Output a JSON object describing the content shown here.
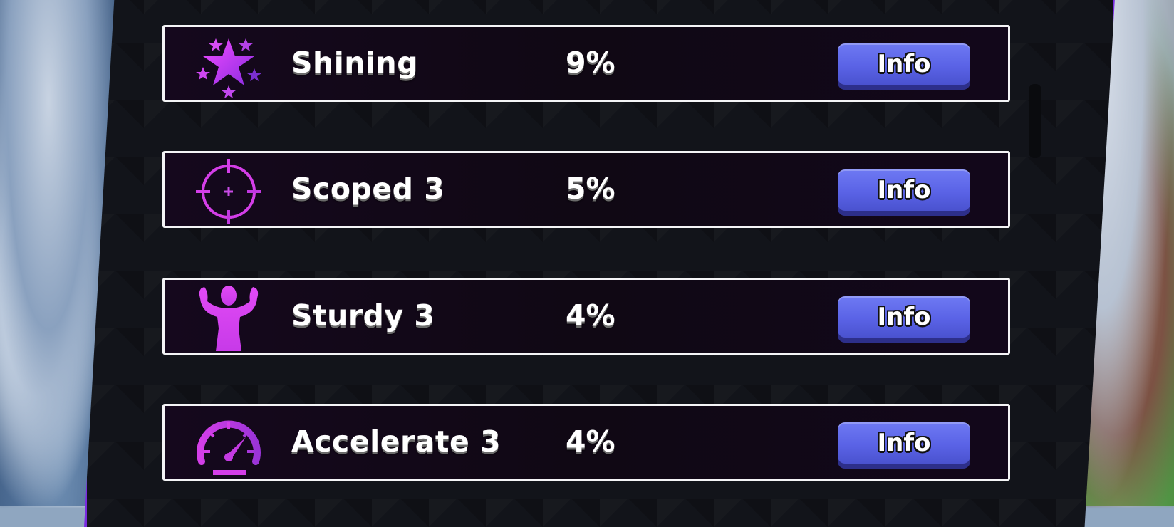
{
  "colors": {
    "accent_pink": "#e040fb",
    "accent_purple": "#7a2be0",
    "info_button": "#5a63e6",
    "row_border": "#f4f4f6"
  },
  "enchants": [
    {
      "name": "Shining",
      "chance": "9%",
      "icon": "shining-stars-icon",
      "button": "Info"
    },
    {
      "name": "Scoped 3",
      "chance": "5%",
      "icon": "crosshair-icon",
      "button": "Info"
    },
    {
      "name": "Sturdy 3",
      "chance": "4%",
      "icon": "flexing-person-icon",
      "button": "Info"
    },
    {
      "name": "Accelerate 3",
      "chance": "4%",
      "icon": "speedometer-icon",
      "button": "Info"
    }
  ]
}
